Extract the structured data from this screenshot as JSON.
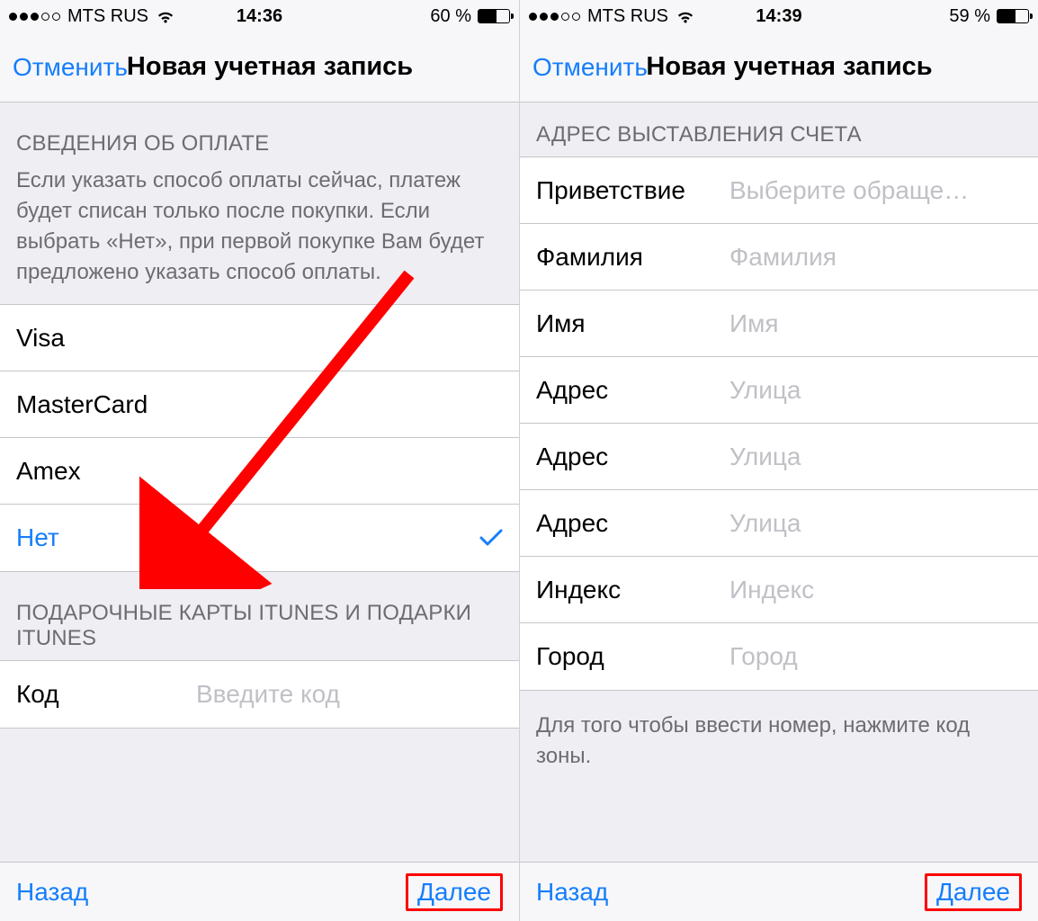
{
  "left": {
    "status": {
      "carrier": "MTS RUS",
      "time": "14:36",
      "battery_text": "60 %",
      "battery_pct": 60,
      "signal_strength": 3
    },
    "nav": {
      "cancel": "Отменить",
      "title": "Новая учетная запись"
    },
    "payment": {
      "header": "СВЕДЕНИЯ ОБ ОПЛАТЕ",
      "desc": "Если указать способ оплаты сейчас, платеж будет списан только после покупки. Если выбрать «Нет», при первой покупке Вам будет предложено указать способ оплаты.",
      "options": [
        "Visa",
        "MasterCard",
        "Amex",
        "Нет"
      ],
      "selected_index": 3
    },
    "gift": {
      "header": "ПОДАРОЧНЫЕ КАРТЫ ITUNES И ПОДАРКИ ITUNES",
      "code_label": "Код",
      "code_placeholder": "Введите код"
    },
    "toolbar": {
      "back": "Назад",
      "next": "Далее"
    }
  },
  "right": {
    "status": {
      "carrier": "MTS RUS",
      "time": "14:39",
      "battery_text": "59 %",
      "battery_pct": 59,
      "signal_strength": 3
    },
    "nav": {
      "cancel": "Отменить",
      "title": "Новая учетная запись"
    },
    "billing": {
      "header": "АДРЕС ВЫСТАВЛЕНИЯ СЧЕТА",
      "fields": [
        {
          "label": "Приветствие",
          "placeholder": "Выберите обраще…"
        },
        {
          "label": "Фамилия",
          "placeholder": "Фамилия"
        },
        {
          "label": "Имя",
          "placeholder": "Имя"
        },
        {
          "label": "Адрес",
          "placeholder": "Улица"
        },
        {
          "label": "Адрес",
          "placeholder": "Улица"
        },
        {
          "label": "Адрес",
          "placeholder": "Улица"
        },
        {
          "label": "Индекс",
          "placeholder": "Индекс"
        },
        {
          "label": "Город",
          "placeholder": "Город"
        }
      ],
      "footer": "Для того чтобы ввести номер, нажмите код зоны."
    },
    "toolbar": {
      "back": "Назад",
      "next": "Далее"
    }
  }
}
